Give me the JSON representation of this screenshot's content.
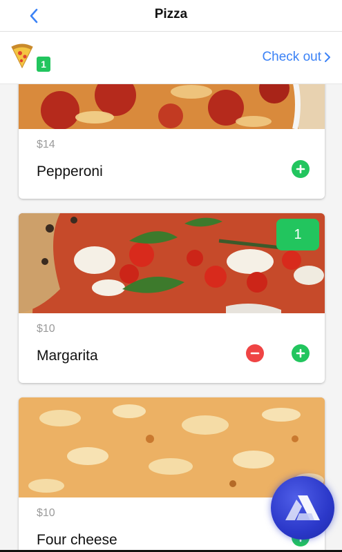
{
  "header": {
    "title": "Pizza",
    "back_icon": "chevron-left-icon"
  },
  "order_bar": {
    "cart_icon": "pizza-slice-icon",
    "cart_count": "1",
    "checkout_label": "Check out",
    "checkout_icon": "chevron-right-icon"
  },
  "colors": {
    "accent": "#3b82f6",
    "add": "#22c55e",
    "remove": "#ef4444",
    "fab": "#2b38c9"
  },
  "items": [
    {
      "name": "Pepperoni",
      "price": "$14",
      "add_icon": "plus-circle-icon"
    },
    {
      "name": "Margarita",
      "price": "$10",
      "quantity": "1",
      "add_icon": "plus-circle-icon",
      "remove_icon": "minus-circle-icon"
    },
    {
      "name": "Four cheese",
      "price": "$10",
      "add_icon": "plus-circle-icon"
    }
  ],
  "fab": {
    "icon": "app-logo-icon"
  }
}
